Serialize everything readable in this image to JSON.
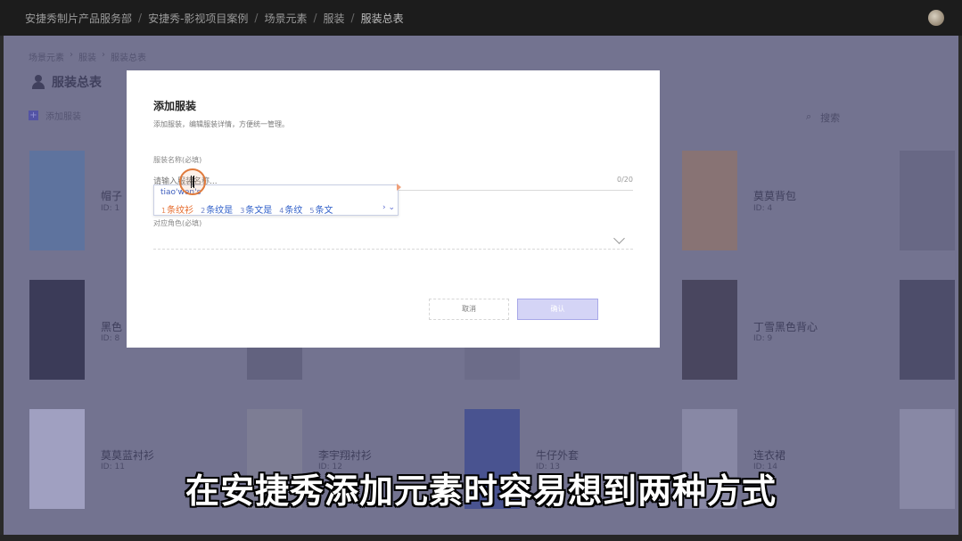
{
  "topbar": {
    "breadcrumbs": [
      "安捷秀制片产品服务部",
      "安捷秀-影视项目案例",
      "场景元素",
      "服装",
      "服装总表"
    ]
  },
  "page": {
    "sub_breadcrumbs": [
      "场景元素",
      "服装",
      "服装总表"
    ],
    "sub_sep": "›",
    "title": "服装总表",
    "add_label": "添加服装",
    "add_plus": "+",
    "search_label": "搜索",
    "search_icon": "⌕"
  },
  "cards": [
    {
      "name": "帽子",
      "id": "ID: 1",
      "color": "#4a6a80"
    },
    {
      "name": "莫莫背包",
      "id": "ID: 4",
      "color": "#8a6a40"
    },
    {
      "name": "",
      "id": "",
      "color": "#5a5a5a"
    },
    {
      "name": "黑色",
      "id": "ID: 8",
      "color": "#151515"
    },
    {
      "name": "",
      "id": "",
      "color": "#505050"
    },
    {
      "name": "",
      "id": "",
      "color": "#606060"
    },
    {
      "name": "丁雪黑色背心",
      "id": "ID: 9",
      "color": "#2a2520"
    },
    {
      "name": "",
      "id": "",
      "color": "#303030"
    },
    {
      "name": "莫莫蓝衬衫",
      "id": "ID: 11",
      "color": "#b0b0b5"
    },
    {
      "name": "李宇翔衬衫",
      "id": "ID: 12",
      "color": "#7a7a70"
    },
    {
      "name": "牛仔外套",
      "id": "ID: 13",
      "color": "#2a3a6a"
    },
    {
      "name": "连衣裙",
      "id": "ID: 14",
      "color": "#8a8a8a"
    },
    {
      "name": "",
      "id": "",
      "color": "#8a8a8a"
    }
  ],
  "modal": {
    "title": "添加服装",
    "description": "添加服装，编辑服装详情，方便统一管理。",
    "name_label": "服装名称",
    "name_required": "(必填)",
    "name_placeholder": "请输入服装名称...",
    "name_counter": "0/20",
    "role_label": "对应角色",
    "role_required": "(必填)",
    "cancel_label": "取消",
    "ok_label": "确认"
  },
  "ime": {
    "pinyin": "tiao'wen's",
    "candidates": [
      {
        "num": "1",
        "text": "条纹衫"
      },
      {
        "num": "2",
        "text": "条纹是"
      },
      {
        "num": "3",
        "text": "条文是"
      },
      {
        "num": "4",
        "text": "条纹"
      },
      {
        "num": "5",
        "text": "条文"
      }
    ],
    "nav": "› ⌄"
  },
  "caption": "在安捷秀添加元素时容易想到两种方式",
  "colors": {
    "accent": "#8484d6",
    "ime_active": "#e66a2a",
    "ime_candidate": "#2f5fc9",
    "cursor_ring": "#e07a3c"
  }
}
